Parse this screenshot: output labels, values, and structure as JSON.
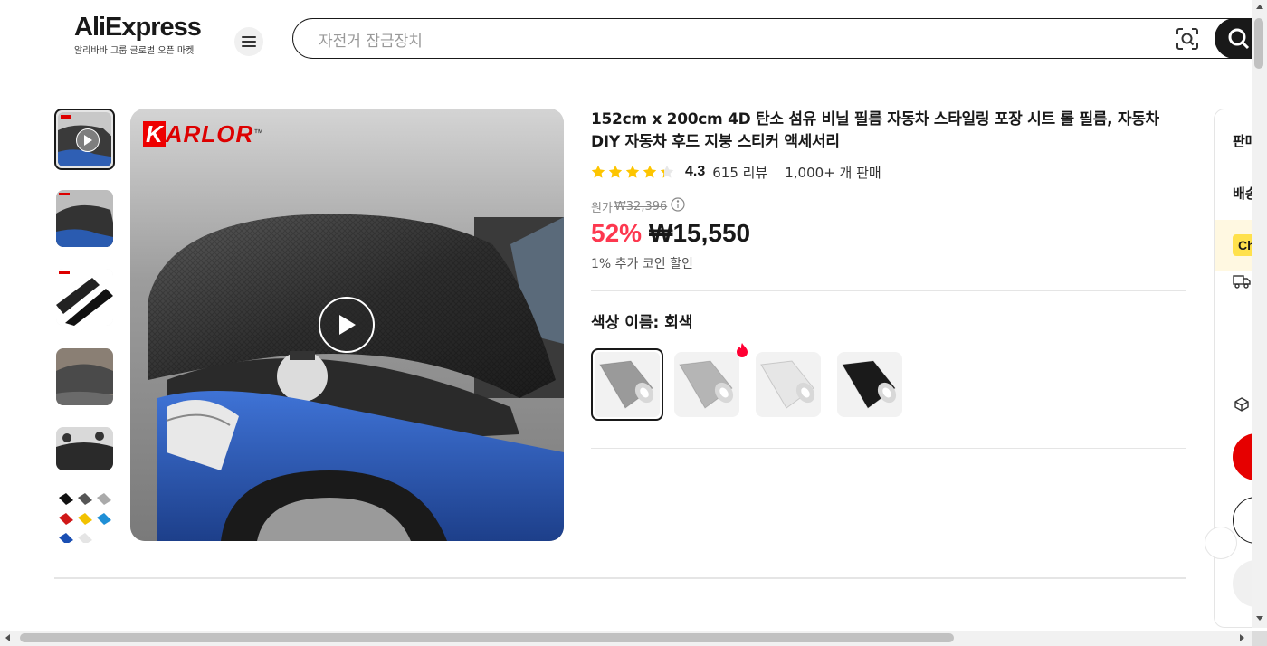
{
  "header": {
    "logo_text": "AliExpress",
    "logo_subtitle": "알리바바 그룹 글로벌 오픈 마켓",
    "search_placeholder": "자전거 잠금장치",
    "menu_icon": "hamburger-icon",
    "camera_icon": "camera-search-icon",
    "search_icon": "search-icon"
  },
  "gallery": {
    "brand_text": "ARLOR",
    "brand_k": "K",
    "brand_tm": "™",
    "thumbnails": [
      {
        "name": "thumb-video",
        "kind": "video"
      },
      {
        "name": "thumb-car-hood",
        "kind": "image"
      },
      {
        "name": "thumb-rolls",
        "kind": "image"
      },
      {
        "name": "thumb-grey-car",
        "kind": "image"
      },
      {
        "name": "thumb-installers",
        "kind": "image"
      },
      {
        "name": "thumb-color-options",
        "kind": "image"
      }
    ]
  },
  "product": {
    "title": "152cm x 200cm 4D 탄소 섬유 비닐 필름 자동차 스타일링 포장 시트 롤 필름, 자동차 DIY 자동차 후드 지붕 스티커 액세서리",
    "rating": "4.3",
    "rating_value": 4.3,
    "reviews": "615 리뷰",
    "sold": "1,000+ 개 판매",
    "original_label": "원가",
    "original_price": "₩32,396",
    "discount": "52%",
    "price": "₩15,550",
    "coin_discount": "1% 추가 코인 할인",
    "color_label": "색상 이름: 회색",
    "swatches": [
      {
        "name": "회색",
        "color": "#9a9a9a",
        "selected": true
      },
      {
        "name": "silver",
        "color": "#b5b5b5",
        "selected": false,
        "hot": true
      },
      {
        "name": "white",
        "color": "#e6e6e6",
        "selected": false
      },
      {
        "name": "black",
        "color": "#1a1a1a",
        "selected": false
      }
    ]
  },
  "right_panel": {
    "seller_label": "판매",
    "shipping_label": "배송",
    "badge_text": "Ch"
  },
  "colors": {
    "accent_red": "#fd384f",
    "brand_red": "#e60000",
    "text": "#191919"
  }
}
